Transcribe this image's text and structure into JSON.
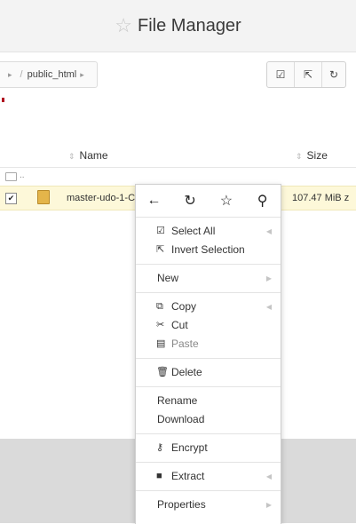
{
  "header": {
    "title": "File Manager",
    "icon": "star-outline-icon"
  },
  "breadcrumb": {
    "sep": "▸",
    "slash": "/",
    "folder": "public_html",
    "trailing": "▸"
  },
  "toolbar": {
    "buttons": [
      {
        "icon": "select-all-icon",
        "glyph": "☑"
      },
      {
        "icon": "share-icon",
        "glyph": "⇱"
      },
      {
        "icon": "refresh-icon",
        "glyph": "↻"
      }
    ]
  },
  "table": {
    "columns": [
      {
        "label": "Name",
        "sort": "⇕"
      },
      {
        "label": "Size",
        "sort": "⇕"
      }
    ],
    "parent_row": {
      "label": ".."
    },
    "rows": [
      {
        "checked": "✔",
        "name": "master-udo-1-C",
        "size": "107.47 MiB z"
      }
    ]
  },
  "context_menu": {
    "iconbar": [
      {
        "icon": "back-arrow-icon",
        "glyph": "←"
      },
      {
        "icon": "refresh-icon",
        "glyph": "↻"
      },
      {
        "icon": "star-outline-icon",
        "glyph": "☆"
      },
      {
        "icon": "search-icon",
        "glyph": "⚲"
      }
    ],
    "arrow_glyph": "◀",
    "groups": [
      [
        {
          "label": "Select All",
          "icon": "select-all-icon",
          "glyph": "☑",
          "arrow": "left"
        },
        {
          "label": "Invert Selection",
          "icon": "invert-selection-icon",
          "glyph": "⇱"
        }
      ],
      [
        {
          "label": "New",
          "arrow": "right"
        }
      ],
      [
        {
          "label": "Copy",
          "icon": "copy-icon",
          "glyph": "⧉",
          "arrow": "left"
        },
        {
          "label": "Cut",
          "icon": "scissors-icon",
          "glyph": "✂"
        },
        {
          "label": "Paste",
          "icon": "paste-icon",
          "glyph": "▤",
          "disabled": true
        }
      ],
      [
        {
          "label": "Delete",
          "icon": "trash-icon",
          "glyph": "🗑"
        }
      ],
      [
        {
          "label": "Rename"
        },
        {
          "label": "Download"
        }
      ],
      [
        {
          "label": "Encrypt",
          "icon": "key-icon",
          "glyph": "⚷"
        }
      ],
      [
        {
          "label": "Extract",
          "icon": "extract-icon",
          "glyph": "■",
          "arrow": "left"
        }
      ],
      [
        {
          "label": "Properties",
          "arrow": "right"
        }
      ]
    ]
  }
}
